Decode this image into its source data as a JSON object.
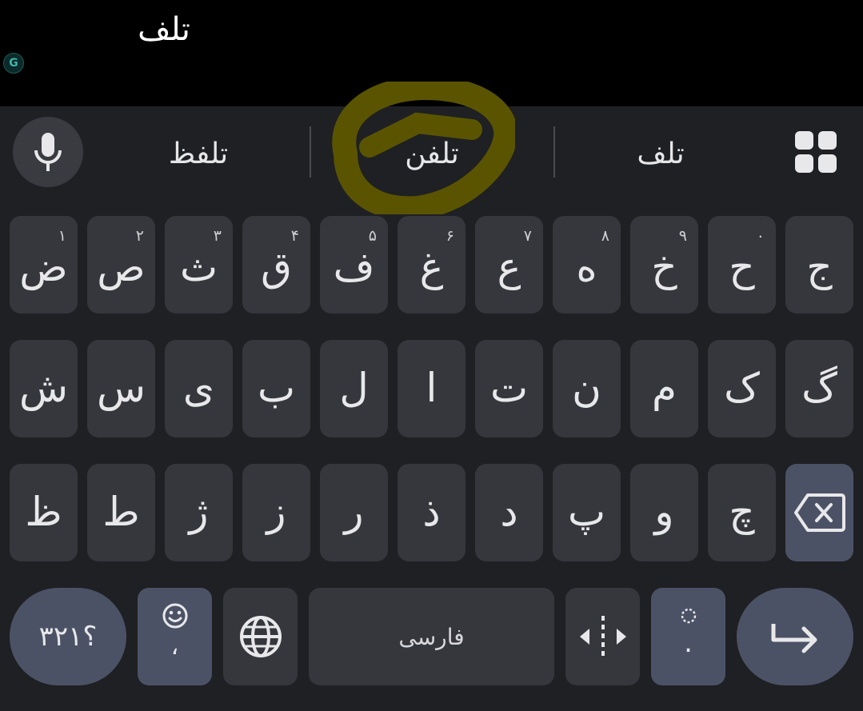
{
  "input": {
    "text": "تلف",
    "badge": "G"
  },
  "suggestions": {
    "left": "تلفظ",
    "center": "تلفن",
    "right": "تلف"
  },
  "icons": {
    "mic": "microphone-icon",
    "grid": "grid-apps-icon",
    "backspace": "backspace-icon",
    "emoji": "emoji-icon",
    "globe": "globe-icon",
    "cursor": "cursor-move-icon",
    "enter": "enter-arrow-icon"
  },
  "rows": {
    "row1": [
      {
        "char": "ض",
        "hint": "۱"
      },
      {
        "char": "ص",
        "hint": "۲"
      },
      {
        "char": "ث",
        "hint": "۳"
      },
      {
        "char": "ق",
        "hint": "۴"
      },
      {
        "char": "ف",
        "hint": "۵"
      },
      {
        "char": "غ",
        "hint": "۶"
      },
      {
        "char": "ع",
        "hint": "۷"
      },
      {
        "char": "ه",
        "hint": "۸"
      },
      {
        "char": "خ",
        "hint": "۹"
      },
      {
        "char": "ح",
        "hint": "۰"
      },
      {
        "char": "ج",
        "hint": ""
      }
    ],
    "row2": [
      "ش",
      "س",
      "ی",
      "ب",
      "ل",
      "ا",
      "ت",
      "ن",
      "م",
      "ک",
      "گ"
    ],
    "row3": [
      "ظ",
      "ط",
      "ژ",
      "ز",
      "ر",
      "ذ",
      "د",
      "پ",
      "و",
      "چ"
    ]
  },
  "bottom": {
    "symbols": "؟۳۲۱",
    "comma": "،",
    "space": "فارسی",
    "period": "."
  },
  "colors": {
    "background": "#1f2023",
    "key": "#36373c",
    "accent_key": "#4c5266",
    "highlight": "#5a5400"
  }
}
